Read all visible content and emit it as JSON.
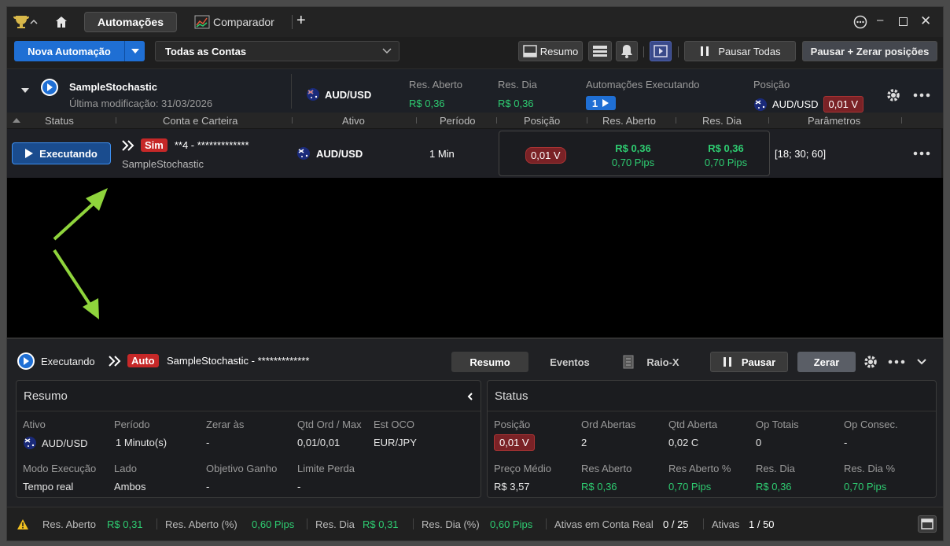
{
  "titlebar": {
    "tabs": [
      {
        "label": "Automações",
        "active": true
      },
      {
        "label": "Comparador",
        "active": false
      }
    ],
    "add_tab": "+"
  },
  "toolbar": {
    "new_automation": "Nova Automação",
    "accounts_select": "Todas as Contas",
    "resumo_btn": "Resumo",
    "pause_all": "Pausar Todas",
    "pause_reset": "Pausar + Zerar posições"
  },
  "summary": {
    "name": "SampleStochastic",
    "last_modified": "Última modificação: 31/03/2026",
    "asset": "AUD/USD",
    "res_aberto_label": "Res. Aberto",
    "res_aberto_value": "R$ 0,36",
    "res_dia_label": "Res. Dia",
    "res_dia_value": "R$ 0,36",
    "executed_label": "Automações Executando",
    "executed_count": "1",
    "posicao_label": "Posição",
    "posicao_asset": "AUD/USD",
    "posicao_value": "0,01 V"
  },
  "table": {
    "headers": [
      "Status",
      "Conta e Carteira",
      "Ativo",
      "Período",
      "Posição",
      "Res. Aberto",
      "Res. Dia",
      "Parâmetros"
    ],
    "row": {
      "status": "Executando",
      "mode": "Sim",
      "account": "**4 - *************",
      "portfolio": "SampleStochastic",
      "asset": "AUD/USD",
      "period": "1 Min",
      "position": "0,01 V",
      "res_aberto": "R$ 0,36",
      "res_aberto_pips": "0,70 Pips",
      "res_dia": "R$ 0,36",
      "res_dia_pips": "0,70 Pips",
      "params": "[18; 30; 60]"
    }
  },
  "panel": {
    "status": "Executando",
    "mode": "Auto",
    "title": "SampleStochastic - *************",
    "tabs": [
      "Resumo",
      "Eventos",
      "Raio-X"
    ],
    "pause_btn": "Pausar",
    "reset_btn": "Zerar",
    "resumo": {
      "title": "Resumo",
      "fields": [
        {
          "label": "Ativo",
          "value": "AUD/USD"
        },
        {
          "label": "Período",
          "value": "1 Minuto(s)"
        },
        {
          "label": "Zerar às",
          "value": "-"
        },
        {
          "label": "Qtd Ord / Max",
          "value": "0,01/0,01"
        },
        {
          "label": "Est OCO",
          "value": "EUR/JPY"
        },
        {
          "label": "Modo Execução",
          "value": "Tempo real"
        },
        {
          "label": "Lado",
          "value": "Ambos"
        },
        {
          "label": "Objetivo Ganho",
          "value": "-"
        },
        {
          "label": "Limite Perda",
          "value": "-"
        }
      ]
    },
    "status_card": {
      "title": "Status",
      "fields": [
        {
          "label": "Posição",
          "value": "0,01 V"
        },
        {
          "label": "Ord Abertas",
          "value": "2"
        },
        {
          "label": "Qtd Aberta",
          "value": "0,02 C"
        },
        {
          "label": "Op Totais",
          "value": "0"
        },
        {
          "label": "Op Consec.",
          "value": "-"
        },
        {
          "label": "Preço Médio",
          "value": "R$ 3,57"
        },
        {
          "label": "Res Aberto",
          "value": "R$ 0,36"
        },
        {
          "label": "Res Aberto %",
          "value": "0,70 Pips"
        },
        {
          "label": "Res. Dia",
          "value": "R$ 0,36"
        },
        {
          "label": "Res. Dia %",
          "value": "0,70 Pips"
        }
      ]
    }
  },
  "statusbar": {
    "res_aberto_label": "Res. Aberto",
    "res_aberto_value": "R$ 0,31",
    "res_aberto_pct_label": "Res. Aberto (%)",
    "res_aberto_pct_value": "0,60 Pips",
    "res_dia_label": "Res. Dia",
    "res_dia_value": "R$ 0,31",
    "res_dia_pct_label": "Res. Dia (%)",
    "res_dia_pct_value": "0,60 Pips",
    "real_label": "Ativas em Conta Real",
    "real_value": "0 / 25",
    "ativas_label": "Ativas",
    "ativas_value": "1 / 50"
  },
  "colors": {
    "accent": "#1f6fd4",
    "positive": "#2ecc71",
    "negative": "#c62828"
  }
}
